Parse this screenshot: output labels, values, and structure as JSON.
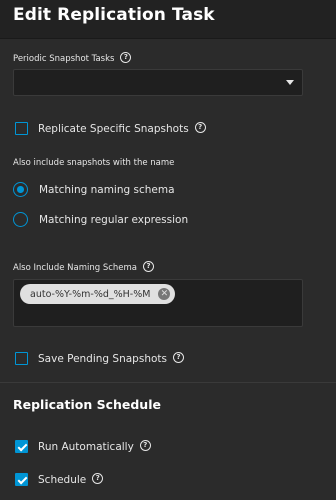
{
  "header": {
    "title": "Edit Replication Task"
  },
  "periodic_snapshot": {
    "label": "Periodic Snapshot Tasks",
    "value": ""
  },
  "replicate_specific": {
    "label": "Replicate Specific Snapshots",
    "checked": false
  },
  "include_name": {
    "label": "Also include snapshots with the name",
    "options": [
      {
        "label": "Matching naming schema",
        "selected": true
      },
      {
        "label": "Matching regular expression",
        "selected": false
      }
    ]
  },
  "naming_schema": {
    "label": "Also Include Naming Schema",
    "chips": [
      "auto-%Y-%m-%d_%H-%M"
    ]
  },
  "save_pending": {
    "label": "Save Pending Snapshots",
    "checked": false
  },
  "schedule_section": {
    "title": "Replication Schedule",
    "run_automatically": {
      "label": "Run Automatically",
      "checked": true
    },
    "schedule": {
      "label": "Schedule",
      "checked": true
    }
  },
  "colors": {
    "accent": "#0095d5",
    "background": "#2b2b2b",
    "input_background": "#1f1f1f"
  },
  "icons": {
    "help": "help-circle-icon",
    "dropdown": "chevron-down-icon",
    "chip_remove": "close-circle-icon"
  }
}
